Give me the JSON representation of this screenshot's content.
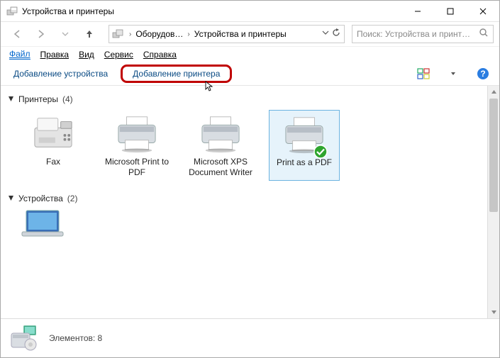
{
  "window": {
    "title": "Устройства и принтеры"
  },
  "breadcrumbs": {
    "parent": "Оборудов…",
    "current": "Устройства и принтеры"
  },
  "search": {
    "placeholder": "Поиск: Устройства и принт…"
  },
  "menu": {
    "file": "Файл",
    "edit": "Правка",
    "view": "Вид",
    "tools": "Сервис",
    "help": "Справка"
  },
  "commands": {
    "add_device": "Добавление устройства",
    "add_printer": "Добавление принтера"
  },
  "sections": {
    "printers": {
      "label": "Принтеры",
      "count": "(4)"
    },
    "devices": {
      "label": "Устройства",
      "count": "(2)"
    }
  },
  "printers": [
    {
      "name": "Fax"
    },
    {
      "name": "Microsoft Print to PDF"
    },
    {
      "name": "Microsoft XPS Document Writer"
    },
    {
      "name": "Print as a PDF"
    }
  ],
  "status": {
    "elements_label": "Элементов:",
    "elements_count": "8"
  }
}
